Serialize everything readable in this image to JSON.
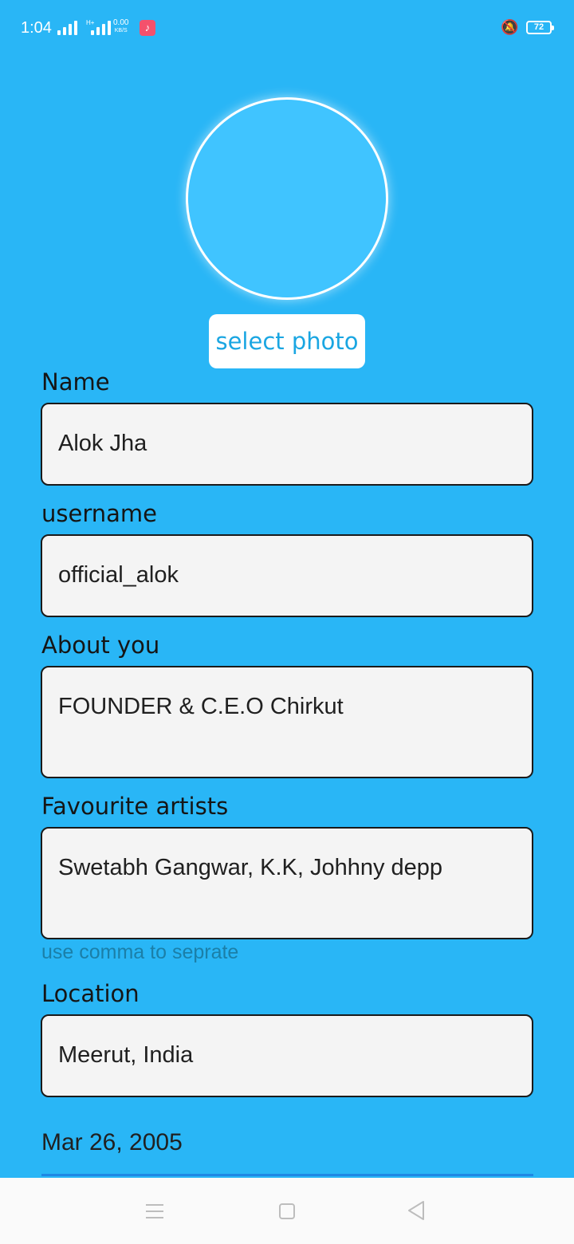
{
  "status_bar": {
    "time": "1:04",
    "network_label": "H+",
    "speed_value": "0.00",
    "speed_unit": "KB/S",
    "battery": "72",
    "icons": [
      "signal-icon",
      "signal-icon",
      "music-app-icon",
      "vibrate-silent-icon",
      "battery-icon"
    ]
  },
  "profile": {
    "select_photo_label": "select photo"
  },
  "form": {
    "name_label": "Name",
    "name_value": "Alok Jha",
    "username_label": "username",
    "username_value": "official_alok",
    "about_label": "About you",
    "about_value": "FOUNDER & C.E.O Chirkut",
    "artists_label": "Favourite artists",
    "artists_value": "Swetabh Gangwar, K.K, Johhny depp",
    "artists_helper": "use comma to seprate",
    "location_label": "Location",
    "location_value": "Meerut, India",
    "dob_value": "Mar 26, 2005"
  },
  "nav_bar": {
    "icons": [
      "menu-icon",
      "home-icon",
      "back-icon"
    ]
  },
  "colors": {
    "background": "#29b6f6",
    "avatar_fill": "#40c4ff",
    "accent_text": "#1aa6e2",
    "field_fill": "#f4f4f4",
    "underline": "#1e88e5"
  }
}
